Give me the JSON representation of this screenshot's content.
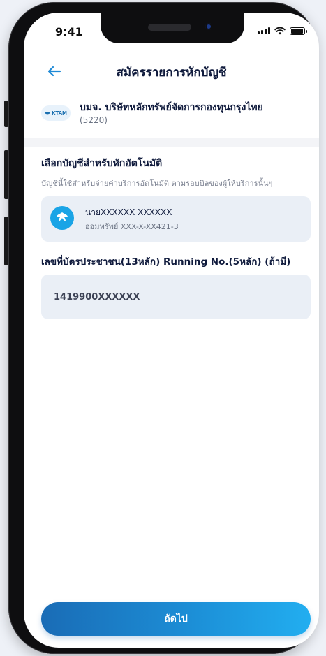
{
  "status_bar": {
    "time": "9:41"
  },
  "header": {
    "title": "สมัครรายการหักบัญชี"
  },
  "company": {
    "logo_text": "KTAM",
    "name": "บมจ. บริษัทหลักทรัพย์จัดการกองทุนกรุงไทย",
    "code": "(5220)"
  },
  "account_section": {
    "title": "เลือกบัญชีสำหรับหักอัตโนมัติ",
    "description": "บัญชีนี้ใช้สำหรับจ่ายค่าบริการอัตโนมัติ ตามรอบบิลของผู้ให้บริการนั้นๆ",
    "account": {
      "name": "นายXXXXXX   XXXXXX",
      "number": "ออมทรัพย์ XXX-X-XX421-3"
    }
  },
  "id_section": {
    "label": "เลขที่บัตรประชาชน(13หลัก) Running No.(5หลัก) (ถ้ามี)",
    "value": "1419900XXXXXX"
  },
  "footer": {
    "next_label": "ถัดไป"
  },
  "colors": {
    "accent": "#1c8ed6",
    "card_bg": "#eaeff6",
    "title": "#0f1a3c"
  }
}
